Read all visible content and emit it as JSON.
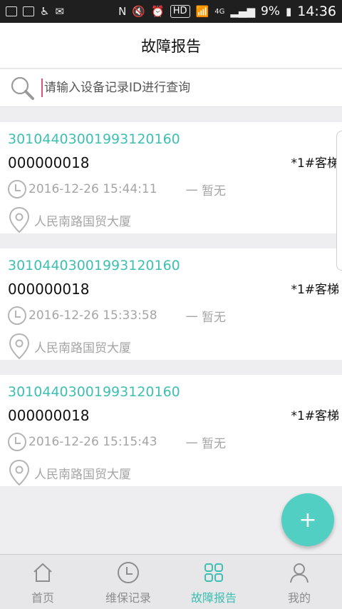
{
  "status_bar": {
    "left_icons": [
      "pay-icon",
      "image-icon",
      "accessibility-icon",
      "mail-icon"
    ],
    "right_icons": [
      "nfc-icon",
      "mute-icon",
      "alarm-icon",
      "wifi-icon",
      "signal-icon",
      "battery-icon"
    ],
    "hd": "HD",
    "network": "4G",
    "battery": "9%",
    "time": "14:36"
  },
  "header": {
    "title": "故障报告"
  },
  "search": {
    "placeholder": "请输入设备记录ID进行查询",
    "value": ""
  },
  "reports": [
    {
      "record_id": "3010440300199312016​0",
      "number": "000000018",
      "unit": "*1#客梯",
      "time": "2016-12-26 15:44:11",
      "status": "一 暂无",
      "location": "人民南路国贸大厦"
    },
    {
      "record_id": "30104403001993120160",
      "number": "000000018",
      "unit": "*1#客梯",
      "time": "2016-12-26 15:33:58",
      "status": "一 暂无",
      "location": "人民南路国贸大厦"
    },
    {
      "record_id": "30104403001993120160",
      "number": "000000018",
      "unit": "*1#客梯",
      "time": "2016-12-26 15:15:43",
      "status": "一 暂无",
      "location": "人民南路国贸大厦"
    }
  ],
  "fab": {
    "label": "+"
  },
  "bottom_nav": {
    "items": [
      {
        "label": "首页",
        "icon": "home-icon",
        "active": false
      },
      {
        "label": "维保记录",
        "icon": "clock-icon",
        "active": false
      },
      {
        "label": "故障报告",
        "icon": "grid-icon",
        "active": true
      },
      {
        "label": "我的",
        "icon": "user-icon",
        "active": false
      }
    ]
  },
  "colors": {
    "accent": "#3dbfb1",
    "fab": "#52cfc3",
    "muted": "#a5a5a5",
    "caret": "#e0507a"
  }
}
